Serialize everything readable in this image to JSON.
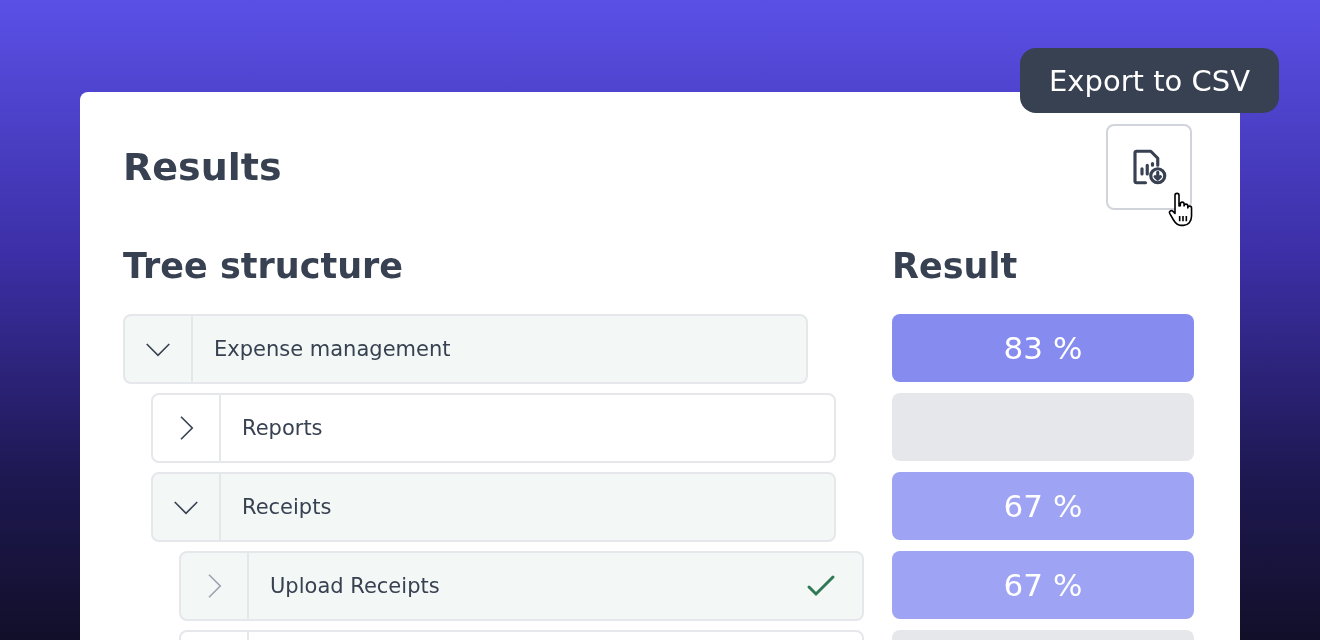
{
  "tooltip": {
    "text": "Export to CSV"
  },
  "title": "Results",
  "export_button": {
    "hovered": true
  },
  "tree_heading": "Tree structure",
  "result_heading": "Result",
  "tree": [
    {
      "label": "Expense management",
      "expanded": true,
      "highlighted": true,
      "has_children": true,
      "checked": false,
      "result": {
        "text": "83 %",
        "color": "#868cef"
      },
      "children": [
        {
          "label": "Reports",
          "expanded": false,
          "highlighted": false,
          "has_children": true,
          "checked": false,
          "result": {
            "color": "#e5e7eb"
          }
        },
        {
          "label": "Receipts",
          "expanded": true,
          "highlighted": true,
          "has_children": true,
          "checked": false,
          "result": {
            "text": "67 %",
            "color": "#9ea3f3"
          },
          "children": [
            {
              "label": "Upload Receipts",
              "expanded": false,
              "highlighted": true,
              "has_children": false,
              "checked": true,
              "result": {
                "text": "67 %",
                "color": "#9ea3f3"
              }
            },
            {
              "highlighted": false,
              "result": {
                "color": "#e5e7eb"
              }
            }
          ]
        }
      ]
    }
  ]
}
